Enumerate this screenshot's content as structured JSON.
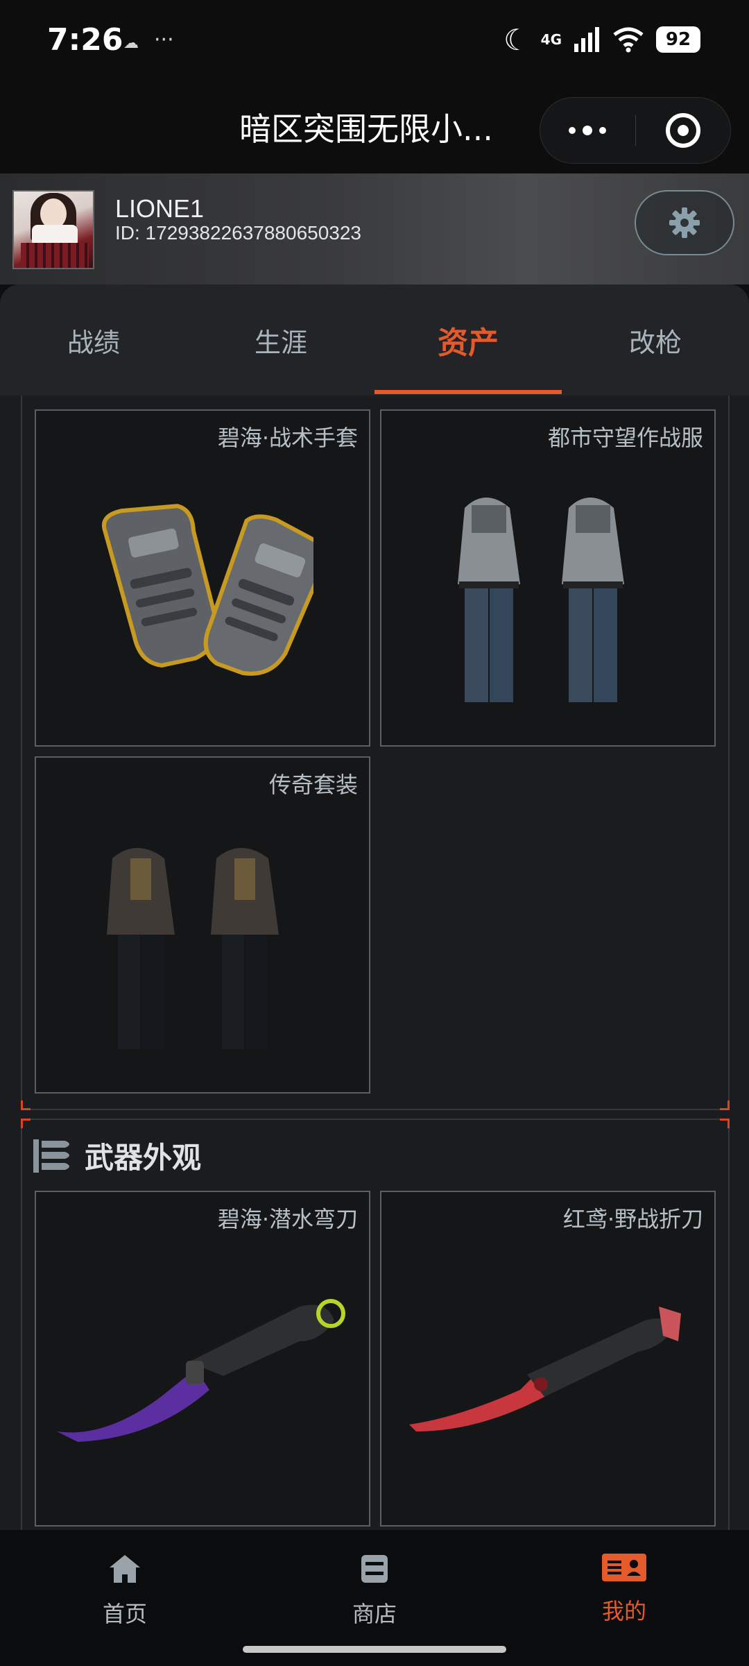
{
  "status_bar": {
    "time": "7:26",
    "extra": "···",
    "network": "4G",
    "battery": "92"
  },
  "header": {
    "title": "暗区突围无限小..."
  },
  "profile": {
    "username": "LIONE1",
    "id_text": "ID: 17293822637880650323"
  },
  "tabs": [
    {
      "label": "战绩",
      "active": false
    },
    {
      "label": "生涯",
      "active": false
    },
    {
      "label": "资产",
      "active": true
    },
    {
      "label": "改枪",
      "active": false
    }
  ],
  "apparel": [
    {
      "label": "碧海·战术手套",
      "icon": "gloves-icon"
    },
    {
      "label": "都市守望作战服",
      "icon": "urban-suit-icon"
    },
    {
      "label": "传奇套装",
      "icon": "legend-suit-icon"
    }
  ],
  "weapon_section": {
    "title": "武器外观",
    "items": [
      {
        "label": "碧海·潜水弯刀",
        "icon": "purple-knife-icon"
      },
      {
        "label": "红鸢·野战折刀",
        "icon": "red-knife-icon"
      }
    ]
  },
  "bottom_nav": [
    {
      "label": "首页",
      "icon": "home-icon",
      "active": false
    },
    {
      "label": "商店",
      "icon": "shop-icon",
      "active": false
    },
    {
      "label": "我的",
      "icon": "profile-card-icon",
      "active": true
    }
  ],
  "colors": {
    "accent": "#e45a2b",
    "background": "#1a1c1f",
    "card": "#141618"
  }
}
